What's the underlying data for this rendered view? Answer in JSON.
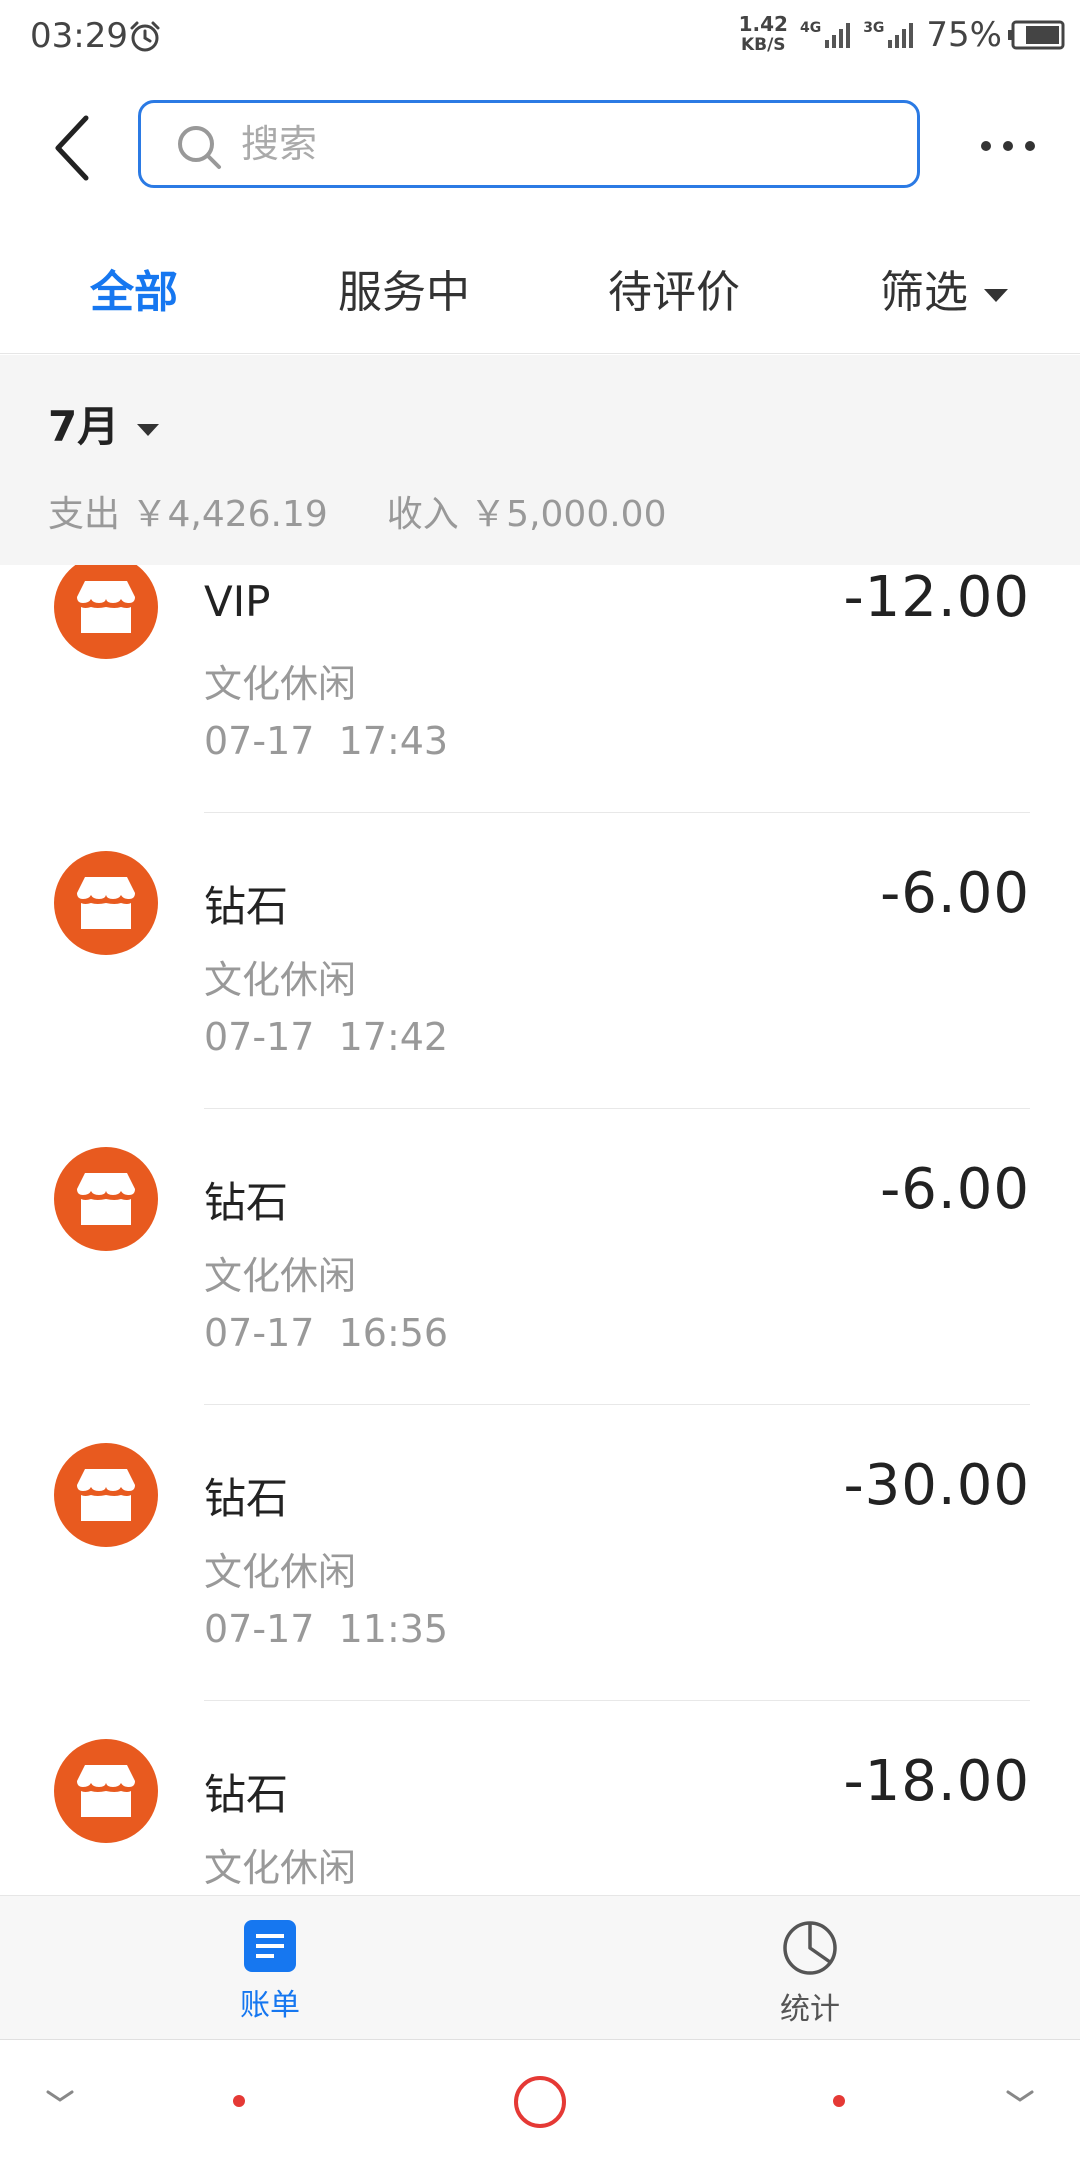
{
  "status_bar": {
    "time": "03:29",
    "net_speed": "1.42",
    "net_speed_unit": "KB/S",
    "sim1_type": "4G",
    "sim2_type": "3G",
    "battery": "75%"
  },
  "search": {
    "placeholder": "搜索",
    "value": ""
  },
  "tabs": [
    {
      "label": "全部",
      "active": true
    },
    {
      "label": "服务中",
      "active": false
    },
    {
      "label": "待评价",
      "active": false
    },
    {
      "label": "筛选",
      "active": false
    }
  ],
  "summary": {
    "month": "7月",
    "expense_label": "支出",
    "expense_amount": "￥4,426.19",
    "income_label": "收入",
    "income_amount": "￥5,000.00"
  },
  "transactions": [
    {
      "title": "VIP",
      "category": "文化休闲",
      "date": "07-17",
      "time": "17:43",
      "amount": "-12.00",
      "icon": "shop-icon"
    },
    {
      "title": "钻石",
      "category": "文化休闲",
      "date": "07-17",
      "time": "17:42",
      "amount": "-6.00",
      "icon": "shop-icon"
    },
    {
      "title": "钻石",
      "category": "文化休闲",
      "date": "07-17",
      "time": "16:56",
      "amount": "-6.00",
      "icon": "shop-icon"
    },
    {
      "title": "钻石",
      "category": "文化休闲",
      "date": "07-17",
      "time": "11:35",
      "amount": "-30.00",
      "icon": "shop-icon"
    },
    {
      "title": "钻石",
      "category": "文化休闲",
      "date": "",
      "time": "",
      "amount": "-18.00",
      "icon": "shop-icon"
    }
  ],
  "bottom_nav": [
    {
      "label": "账单",
      "icon": "bill-icon",
      "active": true
    },
    {
      "label": "统计",
      "icon": "pie-chart-icon",
      "active": false
    }
  ],
  "colors": {
    "accent": "#1677f0",
    "icon_orange": "#e85a1f",
    "nav_red": "#e53935"
  }
}
